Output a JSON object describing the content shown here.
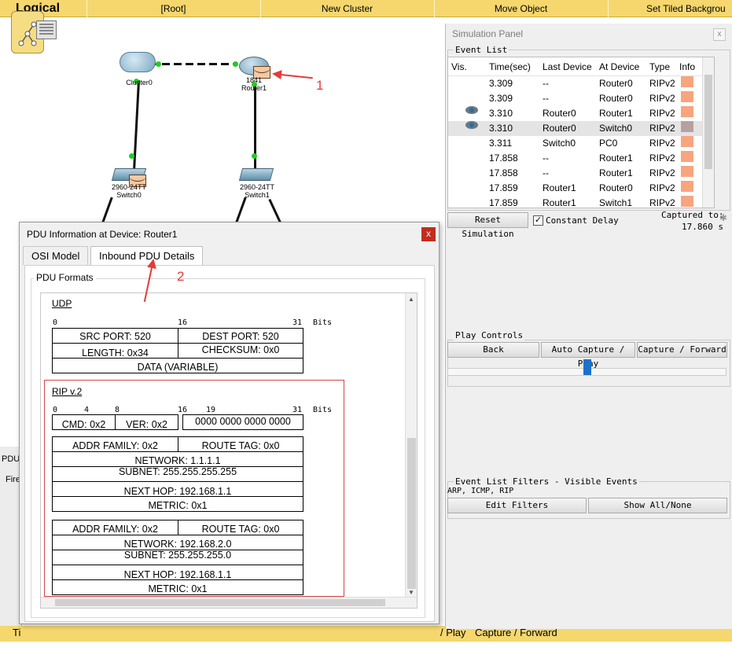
{
  "toolbar": {
    "logical": "Logical",
    "root": "[Root]",
    "new_cluster": "New Cluster",
    "move_object": "Move Object",
    "set_tiled": "Set Tiled Backgrou"
  },
  "topology": {
    "cluster_label": "Cluster0",
    "router_model": "1841",
    "router_label": "Router1",
    "switch0_model": "2960-24TT",
    "switch0_label": "Switch0",
    "switch1_model": "2960-24TT",
    "switch1_label": "Switch1",
    "annotation1": "1",
    "annotation2": "2"
  },
  "left_strip": {
    "pdu": "PDU",
    "fire": "Fire"
  },
  "bottom_bar": {
    "ti": "Ti",
    "play": "/ Play",
    "capture_forward": "Capture / Forward"
  },
  "simulation_panel": {
    "title": "Simulation Panel",
    "close": "x",
    "event_list_label": "Event List",
    "columns": [
      "Vis.",
      "Time(sec)",
      "Last Device",
      "At Device",
      "Type",
      "Info"
    ],
    "events": [
      {
        "vis": false,
        "time": "3.309",
        "last": "--",
        "at": "Router0",
        "type": "RIPv2",
        "selected": false
      },
      {
        "vis": false,
        "time": "3.309",
        "last": "--",
        "at": "Router0",
        "type": "RIPv2",
        "selected": false
      },
      {
        "vis": true,
        "time": "3.310",
        "last": "Router0",
        "at": "Router1",
        "type": "RIPv2",
        "selected": false
      },
      {
        "vis": true,
        "time": "3.310",
        "last": "Router0",
        "at": "Switch0",
        "type": "RIPv2",
        "selected": true
      },
      {
        "vis": false,
        "time": "3.311",
        "last": "Switch0",
        "at": "PC0",
        "type": "RIPv2",
        "selected": false
      },
      {
        "vis": false,
        "time": "17.858",
        "last": "--",
        "at": "Router1",
        "type": "RIPv2",
        "selected": false
      },
      {
        "vis": false,
        "time": "17.858",
        "last": "--",
        "at": "Router1",
        "type": "RIPv2",
        "selected": false
      },
      {
        "vis": false,
        "time": "17.859",
        "last": "Router1",
        "at": "Router0",
        "type": "RIPv2",
        "selected": false
      },
      {
        "vis": false,
        "time": "17.859",
        "last": "Router1",
        "at": "Switch1",
        "type": "RIPv2",
        "selected": false
      }
    ],
    "info_color": "#f7a57f",
    "info_selected_color": "#b9a0a0",
    "reset_simulation": "Reset Simulation",
    "constant_delay": "Constant Delay",
    "constant_delay_checked": true,
    "captured_to_label": "Captured to:",
    "captured_to_value": "17.860 s",
    "play_controls_label": "Play Controls",
    "back": "Back",
    "auto_capture": "Auto Capture / Play",
    "capture_forward": "Capture / Forward",
    "filters_label": "Event List Filters - Visible Events",
    "filters_value": "ARP, ICMP, RIP",
    "edit_filters": "Edit Filters",
    "show_all": "Show All/None"
  },
  "pdu_dialog": {
    "title": "PDU Information at Device: Router1",
    "close": "x",
    "tabs": [
      "OSI Model",
      "Inbound PDU Details"
    ],
    "pdu_formats": "PDU Formats",
    "udp": {
      "title": "UDP",
      "bits": [
        "0",
        "16",
        "31"
      ],
      "bits_label": "Bits",
      "src_port": "SRC PORT: 520",
      "dest_port": "DEST PORT: 520",
      "length": "LENGTH: 0x34",
      "checksum": "CHECKSUM: 0x0",
      "data": "DATA (VARIABLE)"
    },
    "rip": {
      "title": "RIP v.2",
      "bits": [
        "0",
        "4",
        "8",
        "16",
        "19",
        "31"
      ],
      "bits_label": "Bits",
      "cmd": "CMD: 0x2",
      "ver": "VER: 0x2",
      "zeros": "0000 0000 0000 0000",
      "entries": [
        {
          "addr_family": "ADDR FAMILY: 0x2",
          "route_tag": "ROUTE TAG: 0x0",
          "network": "NETWORK: 1.1.1.1",
          "subnet": "SUBNET: 255.255.255.255",
          "next_hop": "NEXT HOP: 192.168.1.1",
          "metric": "METRIC: 0x1"
        },
        {
          "addr_family": "ADDR FAMILY: 0x2",
          "route_tag": "ROUTE TAG: 0x0",
          "network": "NETWORK: 192.168.2.0",
          "subnet": "SUBNET: 255.255.255.0",
          "next_hop": "NEXT HOP: 192.168.1.1",
          "metric": "METRIC: 0x1"
        }
      ]
    }
  }
}
